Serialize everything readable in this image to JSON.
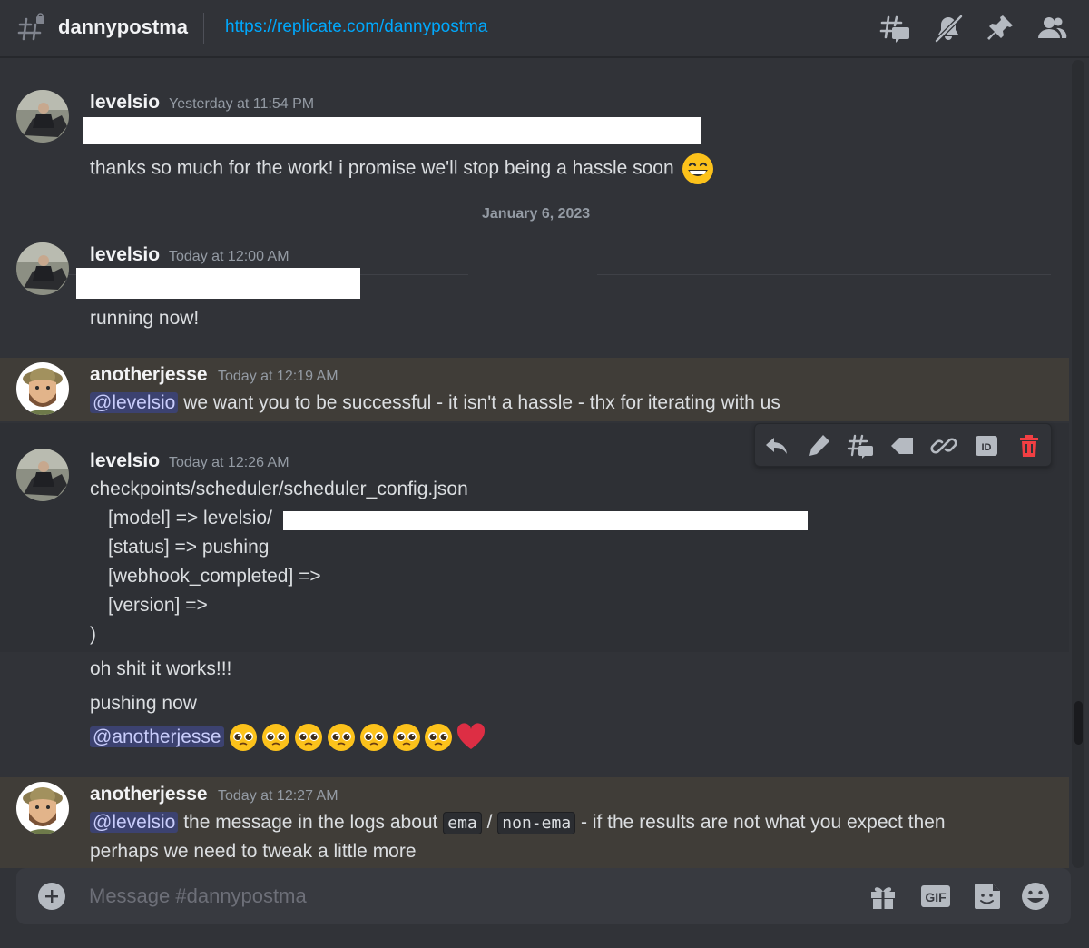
{
  "header": {
    "channel_name": "dannypostma",
    "topic": "https://replicate.com/dannypostma",
    "icons": [
      "threads-icon",
      "mute-bell-icon",
      "pin-icon",
      "members-icon"
    ]
  },
  "divider": {
    "date": "January 6, 2023"
  },
  "messages": [
    {
      "username": "levelsio",
      "timestamp": "Yesterday at 11:54 PM",
      "lines": [
        "thanks so much for the work! i promise we'll stop being a hassle soon"
      ],
      "emoji": "grinning-face-emoji"
    },
    {
      "username": "levelsio",
      "timestamp": "Today at 12:00 AM",
      "lines": [
        "running now!"
      ]
    },
    {
      "username": "anotherjesse",
      "timestamp": "Today at 12:19 AM",
      "mention": "@levelsio",
      "text": "we want you to be successful - it isn't a hassle - thx for iterating with us"
    },
    {
      "username": "levelsio",
      "timestamp": "Today at 12:26 AM",
      "lines": [
        "checkpoints/scheduler/scheduler_config.json",
        "[model] => levelsio/",
        "[status] => pushing",
        "[webhook_completed] =>",
        "[version] =>",
        ")"
      ]
    },
    {
      "continuation": true,
      "lines": [
        "oh shit it works!!!",
        "pushing now"
      ],
      "mention": "@anotherjesse",
      "emojis": [
        "pleading-face-emoji",
        "pleading-face-emoji",
        "pleading-face-emoji",
        "pleading-face-emoji",
        "pleading-face-emoji",
        "pleading-face-emoji",
        "pleading-face-emoji",
        "red-heart-emoji"
      ]
    },
    {
      "username": "anotherjesse",
      "timestamp": "Today at 12:27 AM",
      "mention": "@levelsio",
      "text_a": "the message in the logs about",
      "code_a": "ema",
      "sep": "/",
      "code_b": "non-ema",
      "text_b": "- if the results are not what you expect then",
      "text_c": "perhaps we need to tweak a little more"
    }
  ],
  "toolbar": {
    "icons": [
      "reply-icon",
      "edit-icon",
      "create-thread-icon",
      "mark-unread-icon",
      "copy-link-icon",
      "copy-id-icon",
      "delete-icon"
    ],
    "id_label": "ID"
  },
  "composer": {
    "placeholder": "Message #dannypostma",
    "gif_label": "GIF",
    "icons": [
      "add-icon",
      "gift-icon",
      "gif-icon",
      "sticker-icon",
      "emoji-icon"
    ]
  },
  "colors": {
    "background": "#313338",
    "highlight": "#403d38",
    "link": "#00a8fc",
    "mention_bg": "#3c4270",
    "delete": "#f23f43"
  }
}
